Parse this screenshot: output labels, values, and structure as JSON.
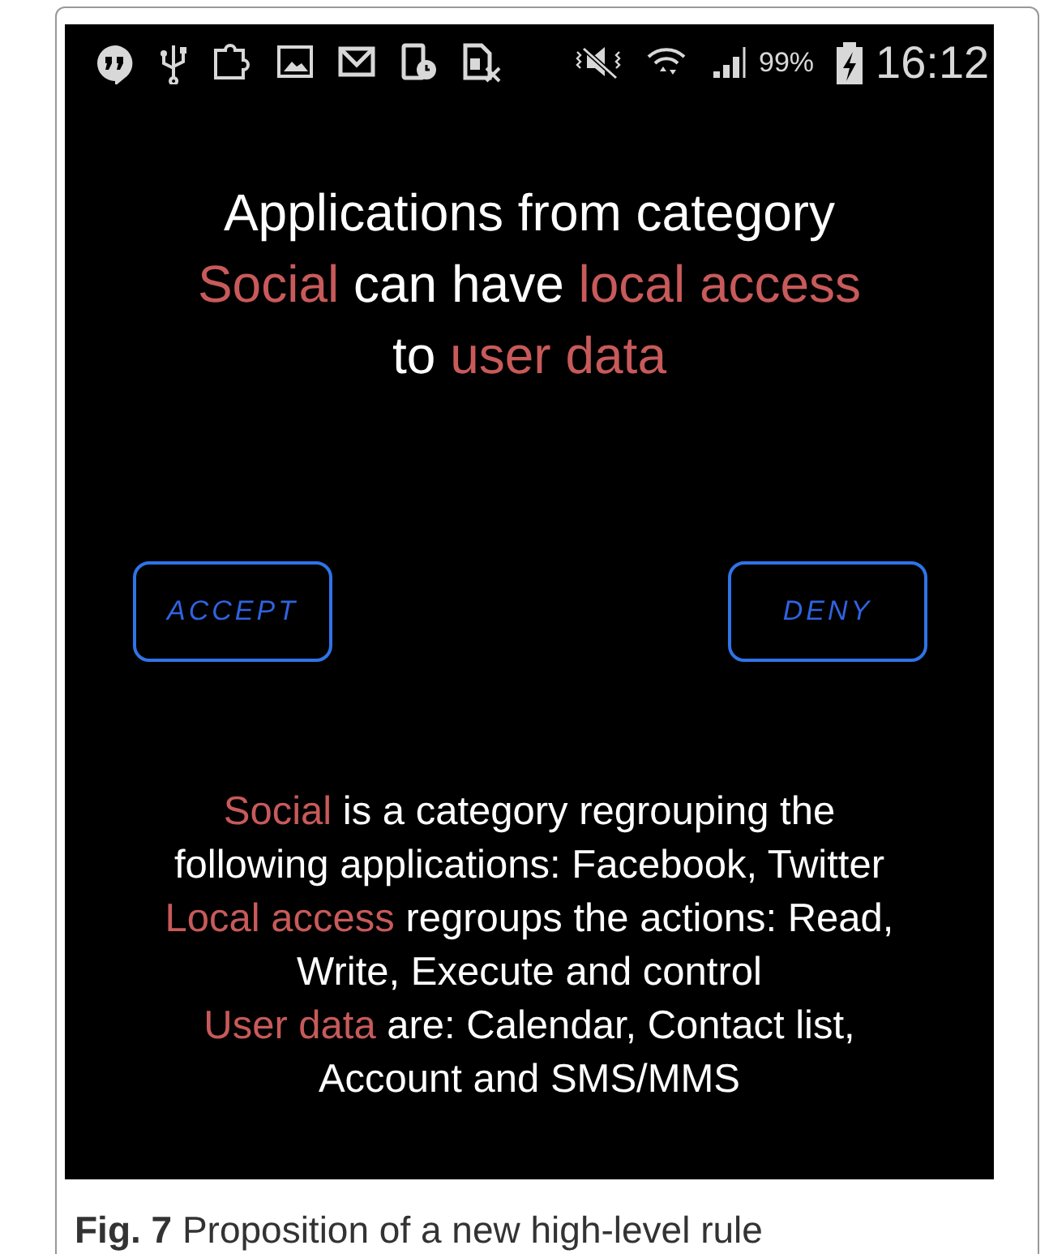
{
  "status_bar": {
    "battery_percent": "99%",
    "time": "16:12"
  },
  "title": {
    "lines": [
      [
        {
          "text": "Applications from category",
          "highlight": false
        }
      ],
      [
        {
          "text": "Social",
          "highlight": true
        },
        {
          "text": " can have ",
          "highlight": false
        },
        {
          "text": "local access",
          "highlight": true
        }
      ],
      [
        {
          "text": "to ",
          "highlight": false
        },
        {
          "text": "user data",
          "highlight": true
        }
      ]
    ]
  },
  "buttons": [
    {
      "label": "ACCEPT"
    },
    {
      "label": "DENY"
    }
  ],
  "explanations": [
    {
      "lines": [
        [
          {
            "text": "Social",
            "highlight": true
          },
          {
            "text": " is a category regrouping the",
            "highlight": false
          }
        ],
        [
          {
            "text": "following applications: Facebook, Twitter",
            "highlight": false
          }
        ]
      ]
    },
    {
      "lines": [
        [
          {
            "text": "Local access",
            "highlight": true
          },
          {
            "text": " regroups the actions: Read,",
            "highlight": false
          }
        ],
        [
          {
            "text": "Write, Execute and control",
            "highlight": false
          }
        ]
      ]
    },
    {
      "lines": [
        [
          {
            "text": "User data",
            "highlight": true
          },
          {
            "text": " are: Calendar, Contact list,",
            "highlight": false
          }
        ],
        [
          {
            "text": "Account and SMS/MMS",
            "highlight": false
          }
        ]
      ]
    }
  ],
  "caption": {
    "label": "Fig. 7",
    "text": "Proposition of a new high-level rule"
  }
}
